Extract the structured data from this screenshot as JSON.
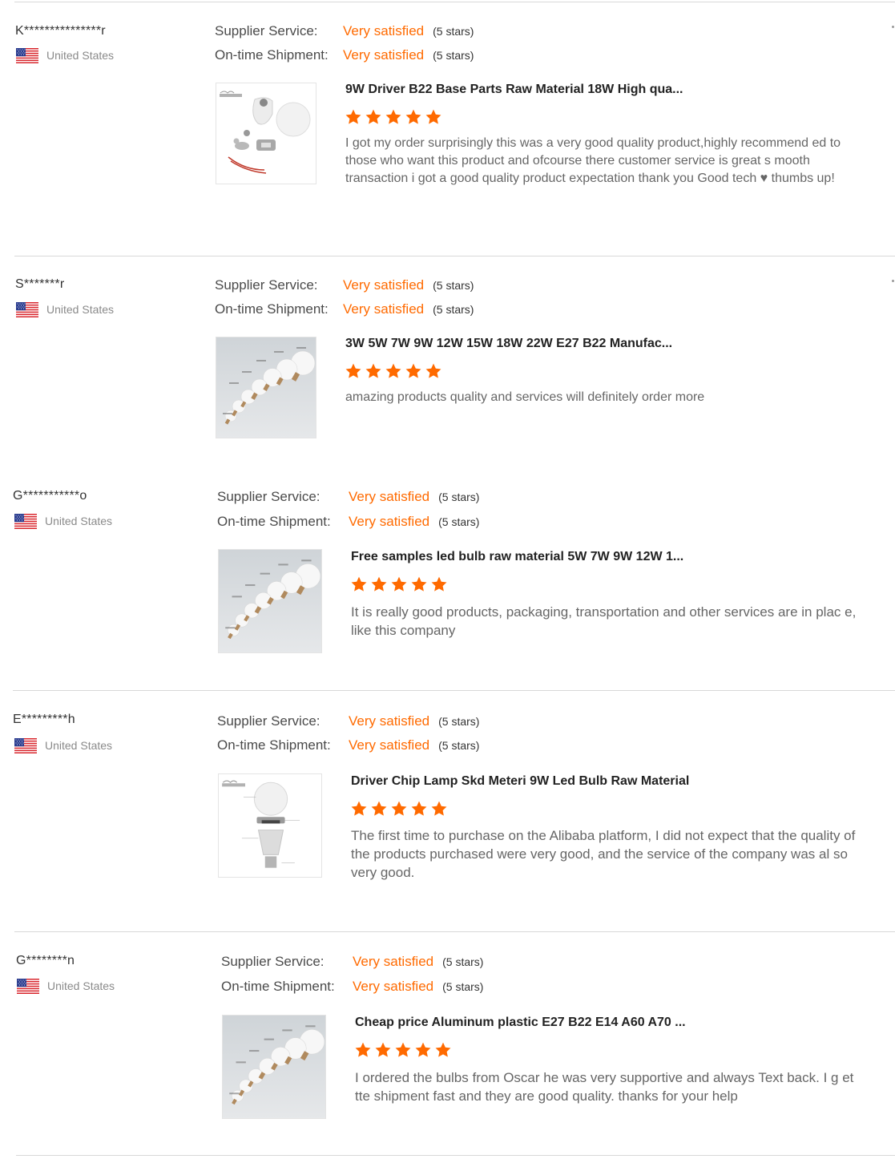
{
  "colors": {
    "accent": "#ff6a00",
    "separator": "#d8d8d8"
  },
  "labels": {
    "supplier_service": "Supplier Service:",
    "ontime_shipment": "On-time Shipment:"
  },
  "reviews": [
    {
      "buyer": "K***************r",
      "country": "United States",
      "flag_icon": "us-flag-icon",
      "supplier_service": {
        "value": "Very satisfied",
        "stars": "(5 stars)"
      },
      "ontime_shipment": {
        "value": "Very satisfied",
        "stars": "(5 stars)"
      },
      "product_title": "9W Driver B22 Base Parts Raw Material 18W High qua...",
      "product_image": "bulb-parts-image",
      "rating": 5,
      "text": "I got my order surprisingly this was a very good quality product,highly recommend ed to those who want this product and ofcourse there customer service is great s mooth transaction  i got a good quality product expectation thank you Good tech ♥ thumbs up!"
    },
    {
      "buyer": "S*******r",
      "country": "United States",
      "flag_icon": "us-flag-icon",
      "supplier_service": {
        "value": "Very satisfied",
        "stars": "(5 stars)"
      },
      "ontime_shipment": {
        "value": "Very satisfied",
        "stars": "(5 stars)"
      },
      "product_title": "3W 5W 7W 9W 12W 15W 18W 22W E27 B22 Manufac...",
      "product_image": "bulb-lineup-image",
      "rating": 5,
      "text": "amazing products quality and services will definitely order more"
    },
    {
      "buyer": "G***********o",
      "country": "United States",
      "flag_icon": "us-flag-icon",
      "supplier_service": {
        "value": "Very satisfied",
        "stars": "(5 stars)"
      },
      "ontime_shipment": {
        "value": "Very satisfied",
        "stars": "(5 stars)"
      },
      "product_title": "Free samples led bulb raw material 5W 7W 9W 12W 1...",
      "product_image": "bulb-lineup-image",
      "rating": 5,
      "text": "It is really good products, packaging, transportation and other services are in plac e, like this company"
    },
    {
      "buyer": "E*********h",
      "country": "United States",
      "flag_icon": "us-flag-icon",
      "supplier_service": {
        "value": "Very satisfied",
        "stars": "(5 stars)"
      },
      "ontime_shipment": {
        "value": "Very satisfied",
        "stars": "(5 stars)"
      },
      "product_title": "Driver Chip Lamp Skd Meteri 9W Led Bulb Raw Material",
      "product_image": "bulb-exploded-image",
      "rating": 5,
      "text": "The first time to purchase on the Alibaba platform, I did not expect that the quality of the products purchased were very good, and the service of the company was al so very good."
    },
    {
      "buyer": "G********n",
      "country": "United States",
      "flag_icon": "us-flag-icon",
      "supplier_service": {
        "value": "Very satisfied",
        "stars": "(5 stars)"
      },
      "ontime_shipment": {
        "value": "Very satisfied",
        "stars": "(5 stars)"
      },
      "product_title": "Cheap price Aluminum plastic E27 B22 E14 A60 A70 ...",
      "product_image": "bulb-lineup-image",
      "rating": 5,
      "text": "I ordered the bulbs from Oscar he was very supportive and always Text back.  I g et tte shipment fast and they are good quality.  thanks for your help"
    }
  ]
}
